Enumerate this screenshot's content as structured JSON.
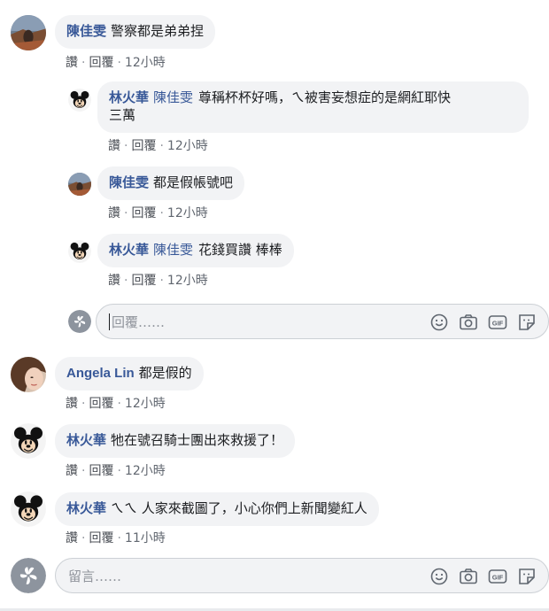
{
  "comments": [
    {
      "name": "陳佳雯",
      "mention": "",
      "text": "警察都是弟弟捏",
      "like": "讚",
      "reply": "回覆",
      "time": "12小時"
    },
    {
      "name": "林火華",
      "mention": "陳佳雯",
      "text": "尊稱杯杯好嗎，ㄟ被害妄想症的是網紅耶快",
      "text2": "三萬",
      "like": "讚",
      "reply": "回覆",
      "time": "12小時"
    },
    {
      "name": "陳佳雯",
      "mention": "",
      "text": "都是假帳號吧",
      "like": "讚",
      "reply": "回覆",
      "time": "12小時"
    },
    {
      "name": "林火華",
      "mention": "陳佳雯",
      "text": "花錢買讚 棒棒",
      "like": "讚",
      "reply": "回覆",
      "time": "12小時"
    },
    {
      "name": "Angela Lin",
      "mention": "",
      "text": "都是假的",
      "like": "讚",
      "reply": "回覆",
      "time": "12小時"
    },
    {
      "name": "林火華",
      "mention": "",
      "text": "牠在號召騎士團出來救援了！",
      "like": "讚",
      "reply": "回覆",
      "time": "12小時"
    },
    {
      "name": "林火華",
      "mention": "",
      "text": "ㄟㄟ 人家來截圖了，小心你們上新聞變紅人",
      "like": "讚",
      "reply": "回覆",
      "time": "11小時"
    }
  ],
  "reply_composer": {
    "placeholder": "回覆……"
  },
  "comment_composer": {
    "placeholder": "留言……"
  },
  "composer_icons": [
    "emoji-icon",
    "camera-icon",
    "gif-icon",
    "sticker-icon"
  ],
  "colors": {
    "name": "#385898",
    "bubble": "#f2f3f5",
    "meta": "#4b4f56"
  }
}
